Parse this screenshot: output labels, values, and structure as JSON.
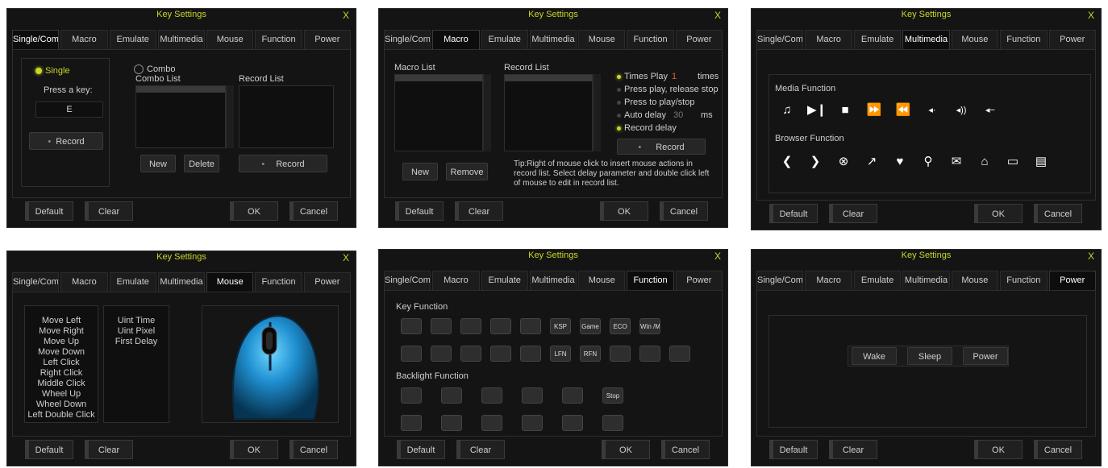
{
  "common": {
    "title": "Key Settings",
    "close": "X",
    "tabs": [
      "Single/Com",
      "Macro",
      "Emulate",
      "Multimedia",
      "Mouse",
      "Function",
      "Power"
    ],
    "default": "Default",
    "clear": "Clear",
    "ok": "OK",
    "cancel": "Cancel"
  },
  "single": {
    "single_label": "Single",
    "press_key": "Press a key:",
    "key_value": "E",
    "record": "Record",
    "combo_label": "Combo",
    "combo_list": "Combo List",
    "record_list": "Record List",
    "new": "New",
    "delete": "Delete",
    "record2": "Record"
  },
  "macro": {
    "macro_list": "Macro List",
    "record_list": "Record List",
    "times_play": "Times Play",
    "times_value": "1",
    "times": "times",
    "opt1": "Press play, release stop",
    "opt2": "Press to play/stop",
    "auto_delay": "Auto delay",
    "delay_value": "30",
    "ms": "ms",
    "record_delay": "Record delay",
    "record": "Record",
    "new": "New",
    "remove": "Remove",
    "tip": "Tip:Right of mouse click to insert mouse actions in record list. Select delay parameter and double click left of mouse to edit in record list."
  },
  "multimedia": {
    "media_function": "Media Function",
    "media_icons": [
      "music-icon",
      "play-pause-icon",
      "stop-icon",
      "next-track-icon",
      "prev-track-icon",
      "volume-down-icon",
      "volume-up-icon",
      "mute-icon"
    ],
    "browser_function": "Browser Function",
    "browser_icons": [
      "back-icon",
      "forward-icon",
      "stop-page-icon",
      "refresh-icon",
      "favorites-icon",
      "search-icon",
      "mail-icon",
      "home-icon",
      "my-computer-icon",
      "calculator-icon"
    ]
  },
  "mouse": {
    "actions": [
      "Move Left",
      "Move Right",
      "Move Up",
      "Move Down",
      "Left Click",
      "Right Click",
      "Middle Click",
      "Wheel Up",
      "Wheel Down",
      "Left Double Click"
    ],
    "params": [
      "Uint Time",
      "Uint Pixel",
      "First Delay"
    ]
  },
  "function": {
    "key_function": "Key Function",
    "row1": [
      "",
      "",
      "",
      "",
      "",
      "KSP",
      "Game",
      "ECO",
      "Win /Mac"
    ],
    "row2": [
      "",
      "",
      "",
      "",
      "",
      "LFN",
      "RFN",
      "",
      "",
      ""
    ],
    "backlight_function": "Backlight Function",
    "row3": [
      "",
      "",
      "",
      "",
      "",
      "Stop"
    ],
    "row4": [
      "",
      "",
      "",
      "",
      "",
      ""
    ]
  },
  "power": {
    "wake": "Wake",
    "sleep": "Sleep",
    "power": "Power"
  }
}
